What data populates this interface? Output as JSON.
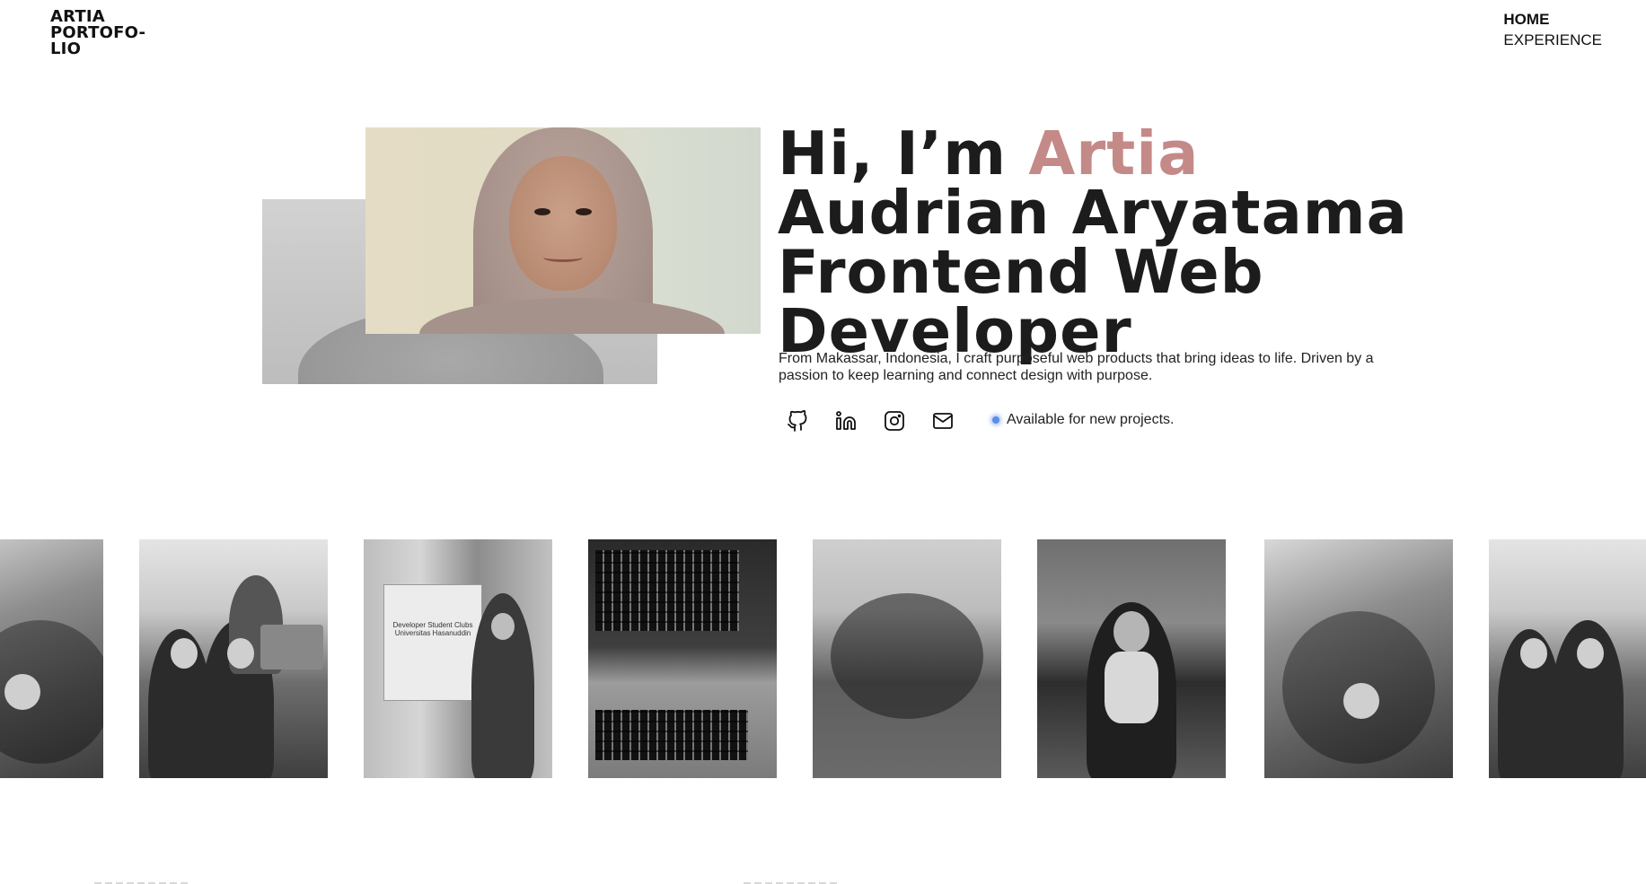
{
  "header": {
    "logo_lines": [
      "ARTIA",
      "PORTOFO-",
      "LIO"
    ],
    "nav": [
      {
        "label": "HOME",
        "active": true
      },
      {
        "label": "EXPERIENCE",
        "active": false
      }
    ]
  },
  "hero": {
    "headline_prefix": "Hi, I’m ",
    "headline_accent": "Artia",
    "headline_rest": " Audrian Aryatama Frontend Web Developer",
    "intro": "From Makassar, Indonesia, I craft purposeful web products that bring ideas to life. Driven by a passion to keep learning and connect design with purpose.",
    "socials": [
      {
        "icon": "github-icon"
      },
      {
        "icon": "linkedin-icon"
      },
      {
        "icon": "instagram-icon"
      },
      {
        "icon": "mail-icon"
      }
    ],
    "status": "Available for new projects.",
    "status_color": "#5b8de8"
  },
  "colors": {
    "accent": "#c48a87",
    "text": "#1c1c1c",
    "background": "#ffffff"
  },
  "gallery": {
    "tiles": [
      "rock",
      "group",
      "banner",
      "laptop",
      "tree",
      "graduation",
      "rock",
      "group"
    ],
    "banner_text": "Developer Student Clubs",
    "banner_subtext": "Universitas Hasanuddin"
  }
}
